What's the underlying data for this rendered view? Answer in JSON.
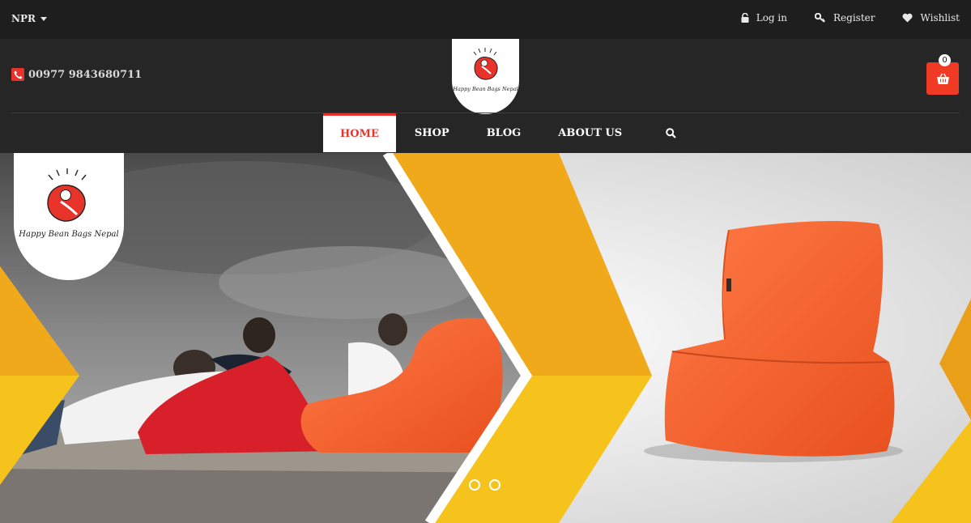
{
  "topbar": {
    "currency": "NPR",
    "links": [
      {
        "label": "Log in",
        "icon": "lock-icon"
      },
      {
        "label": "Register",
        "icon": "key-icon"
      },
      {
        "label": "Wishlist",
        "icon": "heart-icon"
      }
    ]
  },
  "header": {
    "phone": "00977 9843680711",
    "brand": "Happy Bean Bags Nepal",
    "cart_count": "0"
  },
  "nav": {
    "items": [
      {
        "label": "HOME",
        "active": true
      },
      {
        "label": "SHOP",
        "active": false
      },
      {
        "label": "BLOG",
        "active": false
      },
      {
        "label": "ABOUT US",
        "active": false
      }
    ]
  },
  "hero": {
    "brand": "Happy Bean Bags Nepal",
    "slides_count": 2
  },
  "colors": {
    "accent": "#e8332a",
    "cart": "#f03a24",
    "topbar": "#1e1e1e",
    "header": "#262626",
    "yellow": "#f6c21c"
  }
}
